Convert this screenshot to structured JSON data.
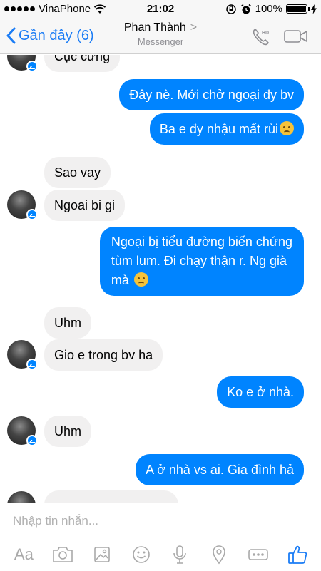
{
  "status_bar": {
    "carrier": "VinaPhone",
    "time": "21:02",
    "battery": "100%"
  },
  "header": {
    "back_label": "Gần đây (6)",
    "contact_name": "Phan Thành",
    "chevron": ">",
    "subtitle": "Messenger",
    "phone_icon": "phone-hd-icon",
    "video_icon": "video-camera-icon"
  },
  "messages": [
    {
      "side": "in",
      "text": "Cục cưng"
    },
    {
      "side": "out",
      "text": "Đây nè. Mới chở ngoại đy bv"
    },
    {
      "side": "out",
      "text": "Ba e đy nhậu mất rùi",
      "emoji": "crying-face"
    },
    {
      "side": "in",
      "text": "Sao vay"
    },
    {
      "side": "in",
      "text": "Ngoai bi gi"
    },
    {
      "side": "out",
      "line1": "Ngoại bị tiểu đường biến chứng",
      "line2": "tùm lum. Đi chạy thận r. Ng già",
      "line3": "mà",
      "emoji": "disappointed-face"
    },
    {
      "side": "in",
      "text": "Uhm"
    },
    {
      "side": "in",
      "text": "Gio e trong bv ha"
    },
    {
      "side": "out",
      "text": "Ko e ở nhà."
    },
    {
      "side": "in",
      "text": "Uhm"
    },
    {
      "side": "out",
      "text": "A ở nhà vs ai. Gia đình hả"
    }
  ],
  "compose": {
    "placeholder": "Nhập tin nhắn...",
    "aa_label": "Aa"
  },
  "colors": {
    "accent": "#0084ff",
    "incoming_bubble": "#f1f0f0",
    "nav_link": "#1a7cf5",
    "toolbar_icon": "#a9a9a9"
  }
}
